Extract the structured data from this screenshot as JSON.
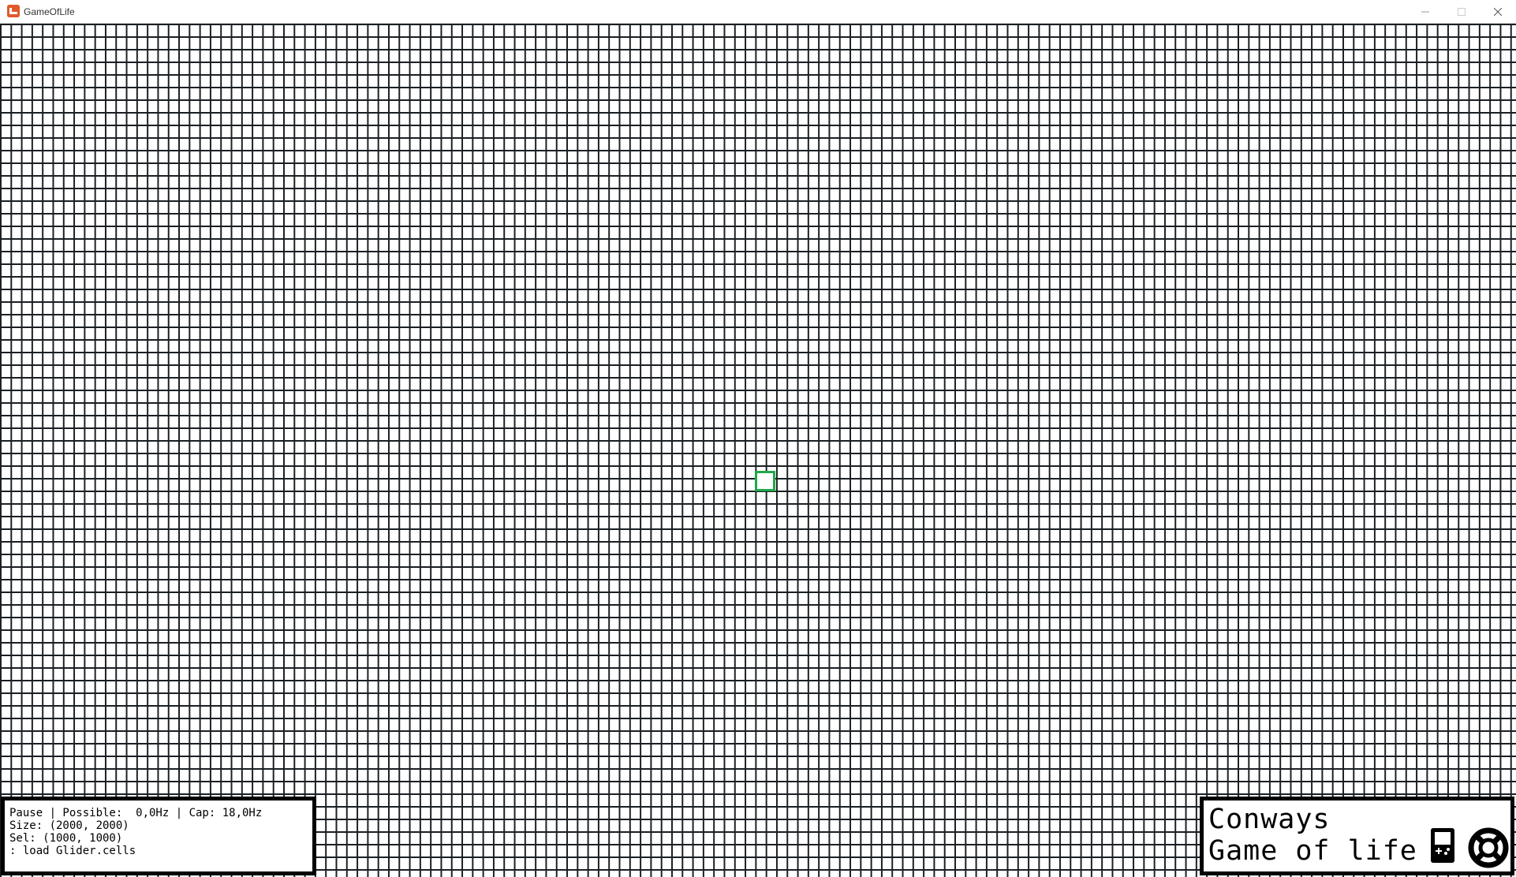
{
  "window": {
    "title": "GameOfLife",
    "app_icon": "monogame-logo-icon",
    "controls": [
      "minimize-icon",
      "maximize-icon",
      "close-icon"
    ]
  },
  "grid": {
    "line_color": "#1a1f24",
    "background_color": "#ffffff",
    "cursor_color": "#1fa84a"
  },
  "info_panel": {
    "status_line": "Pause | Possible:  0,0Hz | Cap: 18,0Hz",
    "size_line": "Size: (2000, 2000)",
    "selection_line": "Sel: (1000, 1000)",
    "command_line": ": load Glider.cells"
  },
  "title_panel": {
    "line1": "Conways",
    "line2": "Game of life",
    "icons": [
      "gameboy-icon",
      "lifebuoy-icon"
    ]
  }
}
